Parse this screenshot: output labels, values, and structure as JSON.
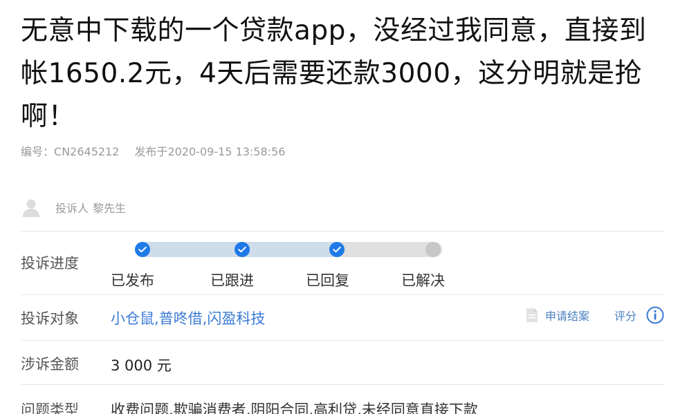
{
  "complaint": {
    "title": "无意中下载的一个贷款app，没经过我同意，直接到帐1650.2元，4天后需要还款3000，这分明就是抢啊！",
    "meta": {
      "id_label": "编号：",
      "id_value": "CN2645212",
      "published_label": "发布于",
      "published_value": "2020-09-15 13:58:56"
    },
    "complainant": {
      "label": "投诉人",
      "name": "黎先生",
      "avatar_icon": "user-avatar-icon"
    },
    "progress": {
      "label": "投诉进度",
      "completed_fraction": 0.67,
      "steps": [
        {
          "label": "已发布",
          "done": true
        },
        {
          "label": "已跟进",
          "done": true
        },
        {
          "label": "已回复",
          "done": true
        },
        {
          "label": "已解决",
          "done": false
        }
      ]
    },
    "target": {
      "label": "投诉对象",
      "value": "小仓鼠,普咚借,闪盈科技",
      "apply_close_label": "申请结案",
      "rate_label": "评分",
      "doc_icon": "document-icon",
      "info_icon": "info-icon"
    },
    "amount": {
      "label": "涉诉金额",
      "value": "3 000 元"
    },
    "issue_type": {
      "label": "问题类型",
      "value": "收费问题,欺骗消费者,阴阳合同,高利贷,未经同意直接下款"
    }
  },
  "colors": {
    "accent": "#1f7ae8",
    "link": "#3b7bd6",
    "muted": "#9a9a9a",
    "divider": "#e6e6e6"
  }
}
